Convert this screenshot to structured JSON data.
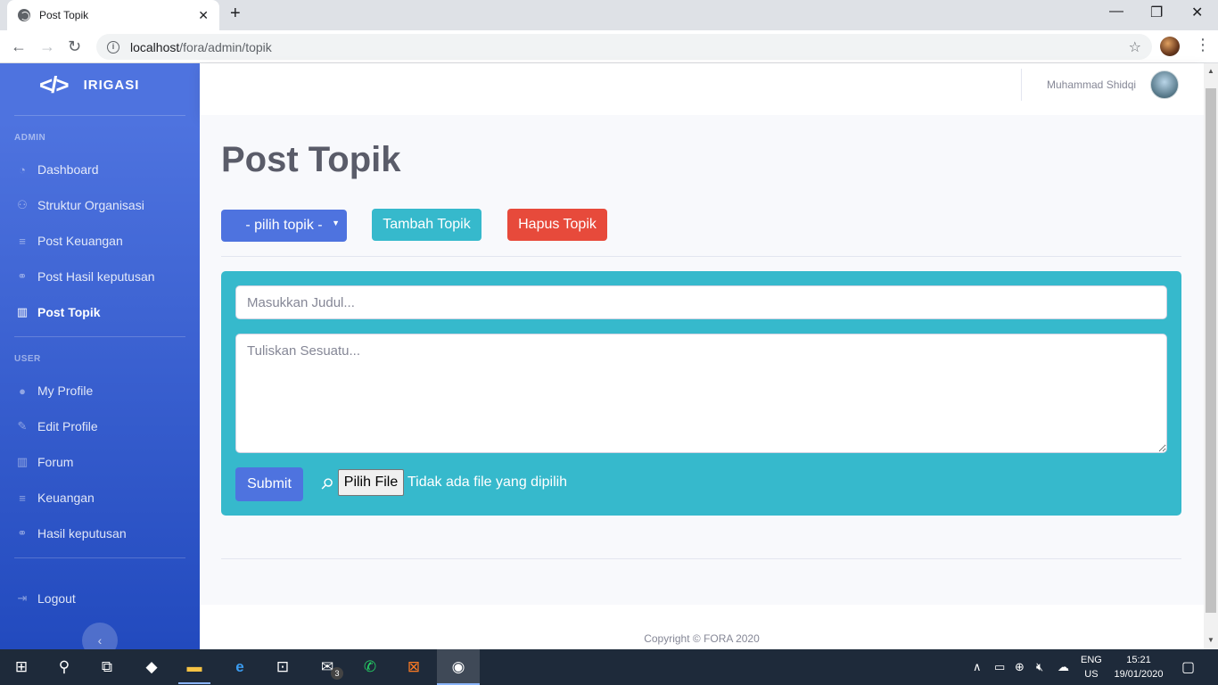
{
  "browser": {
    "tab_title": "Post Topik",
    "url_host": "localhost",
    "url_path": "/fora/admin/topik"
  },
  "sidebar": {
    "brand_logo": "</>",
    "brand_name": "IRIGASI",
    "admin_heading": "ADMIN",
    "admin_items": [
      {
        "label": "Dashboard",
        "icon": "dashboard-icon"
      },
      {
        "label": "Struktur Organisasi",
        "icon": "sitemap-icon"
      },
      {
        "label": "Post Keuangan",
        "icon": "coins-icon"
      },
      {
        "label": "Post Hasil keputusan",
        "icon": "handshake-icon"
      },
      {
        "label": "Post Topik",
        "icon": "book-open-icon",
        "active": true
      }
    ],
    "user_heading": "USER",
    "user_items": [
      {
        "label": "My Profile",
        "icon": "user-icon"
      },
      {
        "label": "Edit Profile",
        "icon": "edit-icon"
      },
      {
        "label": "Forum",
        "icon": "book-open-icon"
      },
      {
        "label": "Keuangan",
        "icon": "coins-icon"
      },
      {
        "label": "Hasil keputusan",
        "icon": "handshake-icon"
      }
    ],
    "logout_label": "Logout",
    "toggle_glyph": "‹"
  },
  "topbar": {
    "user_name": "Muhammad Shidqi"
  },
  "main": {
    "page_title": "Post Topik",
    "topic_select": "- pilih topik -",
    "add_topic_label": "Tambah Topik",
    "delete_topic_label": "Hapus Topik",
    "title_placeholder": "Masukkan Judul...",
    "body_placeholder": "Tuliskan Sesuatu...",
    "submit_label": "Submit",
    "file_button_label": "Pilih File",
    "file_status": "Tidak ada file yang dipilih"
  },
  "footer": {
    "copyright": "Copyright © FORA 2020"
  },
  "taskbar": {
    "mail_badge": "3",
    "lang_top": "ENG",
    "lang_bottom": "US",
    "time": "15:21",
    "date": "19/01/2020"
  },
  "colors": {
    "primary": "#4e73df",
    "info": "#36b9cc",
    "danger": "#e74a3b"
  }
}
